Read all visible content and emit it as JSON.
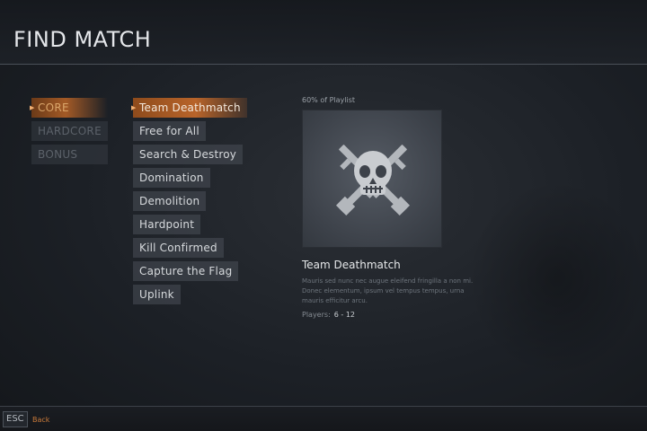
{
  "header": {
    "title": "FIND MATCH"
  },
  "categories": [
    {
      "label": "CORE",
      "active": true
    },
    {
      "label": "HARDCORE",
      "active": false
    },
    {
      "label": "BONUS",
      "active": false
    }
  ],
  "modes": [
    {
      "label": "Team Deathmatch",
      "active": true
    },
    {
      "label": "Free for All",
      "active": false
    },
    {
      "label": "Search & Destroy",
      "active": false
    },
    {
      "label": "Domination",
      "active": false
    },
    {
      "label": "Demolition",
      "active": false
    },
    {
      "label": "Hardpoint",
      "active": false
    },
    {
      "label": "Kill Confirmed",
      "active": false
    },
    {
      "label": "Capture the Flag",
      "active": false
    },
    {
      "label": "Uplink",
      "active": false
    }
  ],
  "selected": {
    "playlist_share": "60% of Playlist",
    "emblem_icon": "skull-crossed-rifles-icon",
    "name": "Team Deathmatch",
    "description": "Mauris sed nunc nec augue eleifend fringilla a non mi. Donec elementum, ipsum vel tempus tempus, urna mauris efficitur arcu.",
    "players_label": "Players:",
    "players_value": "6 - 12"
  },
  "footer": {
    "key": "ESC",
    "action": "Back"
  },
  "colors": {
    "accent": "#b8642a",
    "accent_text": "#d9a56a",
    "back_text": "#c97a3a"
  }
}
